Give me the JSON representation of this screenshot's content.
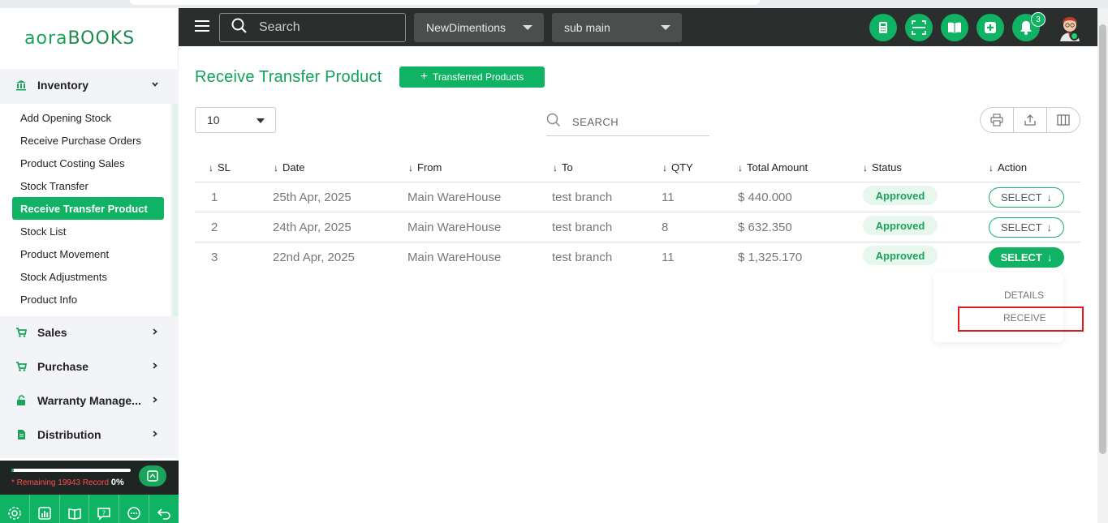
{
  "app": {
    "logo_left": "aora",
    "logo_right": "BOOKS"
  },
  "topbar": {
    "search_placeholder": "Search",
    "company_select": "NewDimentions",
    "branch_select": "sub main",
    "notification_count": "3"
  },
  "sidebar": {
    "inventory_label": "Inventory",
    "inventory_items": [
      "Add Opening Stock",
      "Receive Purchase Orders",
      "Product Costing Sales",
      "Stock Transfer",
      "Receive Transfer Product",
      "Stock List",
      "Product Movement",
      "Stock Adjustments",
      "Product Info"
    ],
    "groups": [
      "Sales",
      "Purchase",
      "Warranty Manage...",
      "Distribution"
    ],
    "remaining_text": "* Remaining 19943 Record",
    "percent": "0%",
    "progress_fraction": 0.02
  },
  "main": {
    "title": "Receive Transfer Product",
    "transferred_button": "Transferred Products",
    "page_size": "10",
    "search_placeholder": "SEARCH",
    "columns": [
      "SL",
      "Date",
      "From",
      "To",
      "QTY",
      "Total Amount",
      "Status",
      "Action"
    ],
    "rows": [
      {
        "sl": "1",
        "date": "25th Apr, 2025",
        "from": "Main WareHouse",
        "to": "test branch",
        "qty": "11",
        "amount": "$ 440.000",
        "status": "Approved",
        "action": "SELECT"
      },
      {
        "sl": "2",
        "date": "24th Apr, 2025",
        "from": "Main WareHouse",
        "to": "test branch",
        "qty": "8",
        "amount": "$ 632.350",
        "status": "Approved",
        "action": "SELECT"
      },
      {
        "sl": "3",
        "date": "22nd Apr, 2025",
        "from": "Main WareHouse",
        "to": "test branch",
        "qty": "11",
        "amount": "$ 1,325.170",
        "status": "Approved",
        "action": "SELECT"
      }
    ],
    "dropdown": {
      "details": "DETAILS",
      "receive": "RECEIVE"
    }
  },
  "colors": {
    "brand_green": "#10b363",
    "topbar_bg": "#2a2e2c",
    "highlight_red": "#e01b1b"
  }
}
